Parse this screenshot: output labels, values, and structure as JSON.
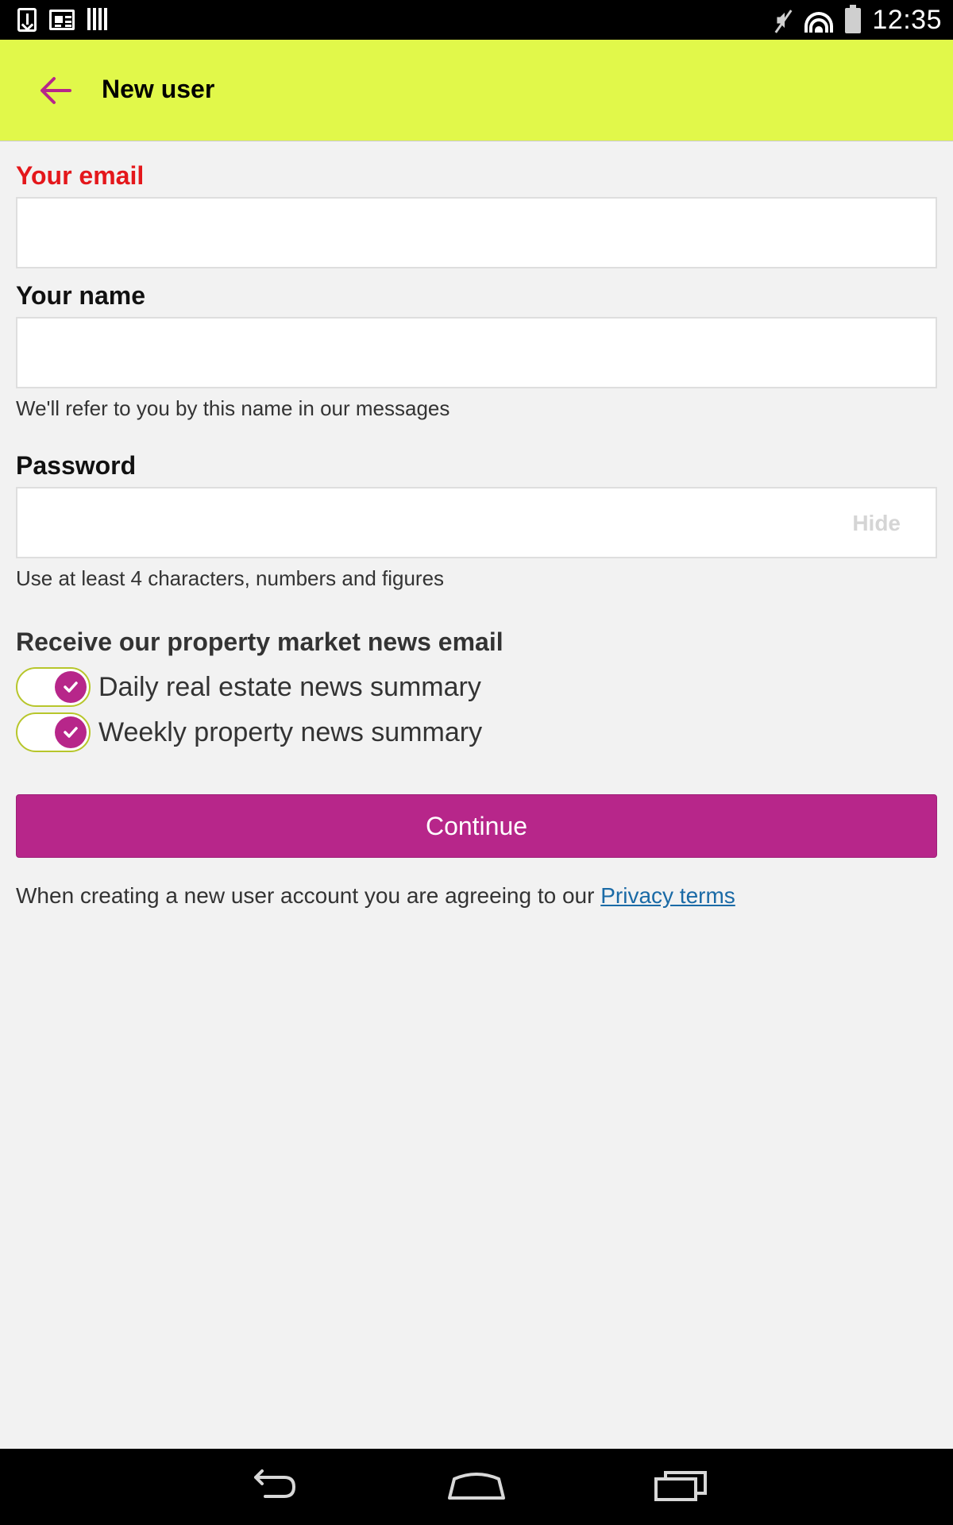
{
  "status_bar": {
    "time": "12:35",
    "left_icons": [
      "download-icon",
      "news-icon",
      "barcode-icon"
    ],
    "right_icons": [
      "mute-icon",
      "wifi-icon",
      "battery-icon"
    ]
  },
  "app_bar": {
    "title": "New user",
    "back_icon": "arrow-left-icon",
    "background": "#e1f84a",
    "accent": "#b7268a"
  },
  "form": {
    "email": {
      "label": "Your email",
      "value": "",
      "placeholder": ""
    },
    "name": {
      "label": "Your name",
      "value": "",
      "placeholder": "",
      "hint": "We'll refer to you by this name in our messages"
    },
    "password": {
      "label": "Password",
      "value": "",
      "placeholder": "",
      "toggle_label": "Hide",
      "hint": "Use at least 4 characters, numbers and figures"
    }
  },
  "newsletter": {
    "title": "Receive our property market news email",
    "options": [
      {
        "label": "Daily real estate news summary",
        "checked": true
      },
      {
        "label": "Weekly property news summary",
        "checked": true
      }
    ]
  },
  "continue_label": "Continue",
  "terms": {
    "text": "When creating a new user account you are agreeing to our ",
    "link": "Privacy terms"
  },
  "colors": {
    "error": "#e4171b",
    "primary": "#b7268a",
    "link": "#1a6aa6"
  }
}
